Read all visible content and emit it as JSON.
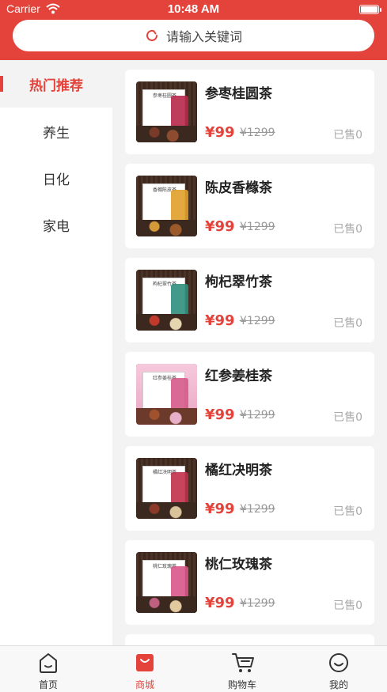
{
  "status": {
    "carrier": "Carrier",
    "time": "10:48 AM"
  },
  "search": {
    "placeholder": "请输入关键词"
  },
  "categories": [
    {
      "label": "热门推荐",
      "active": true
    },
    {
      "label": "养生",
      "active": false
    },
    {
      "label": "日化",
      "active": false
    },
    {
      "label": "家电",
      "active": false
    }
  ],
  "products": [
    {
      "name": "参枣桂圆茶",
      "price": "¥99",
      "old_price": "¥1299",
      "sold": "已售0",
      "box_label": "参枣桂圆茶",
      "accent": "#b8284a"
    },
    {
      "name": "陈皮香橼茶",
      "price": "¥99",
      "old_price": "¥1299",
      "sold": "已售0",
      "box_label": "香橼陈皮茶",
      "accent": "#e0a02a"
    },
    {
      "name": "枸杞翠竹茶",
      "price": "¥99",
      "old_price": "¥1299",
      "sold": "已售0",
      "box_label": "枸杞翠竹茶",
      "accent": "#2f8f7e"
    },
    {
      "name": "红参姜桂茶",
      "price": "¥99",
      "old_price": "¥1299",
      "sold": "已售0",
      "box_label": "红参姜桂茶",
      "accent": "#d45a8a"
    },
    {
      "name": "橘红决明茶",
      "price": "¥99",
      "old_price": "¥1299",
      "sold": "已售0",
      "box_label": "橘红决明茶",
      "accent": "#c0304a"
    },
    {
      "name": "桃仁玫瑰茶",
      "price": "¥99",
      "old_price": "¥1299",
      "sold": "已售0",
      "box_label": "桃仁玫瑰茶",
      "accent": "#d8578a"
    }
  ],
  "tabs": [
    {
      "label": "首页",
      "icon": "home-icon",
      "active": false
    },
    {
      "label": "商城",
      "icon": "shop-bag-icon",
      "active": true
    },
    {
      "label": "购物车",
      "icon": "cart-icon",
      "active": false
    },
    {
      "label": "我的",
      "icon": "smiley-icon",
      "active": false
    }
  ],
  "colors": {
    "brand": "#e3433a",
    "price": "#e3433a",
    "background": "#f3f3f3"
  }
}
